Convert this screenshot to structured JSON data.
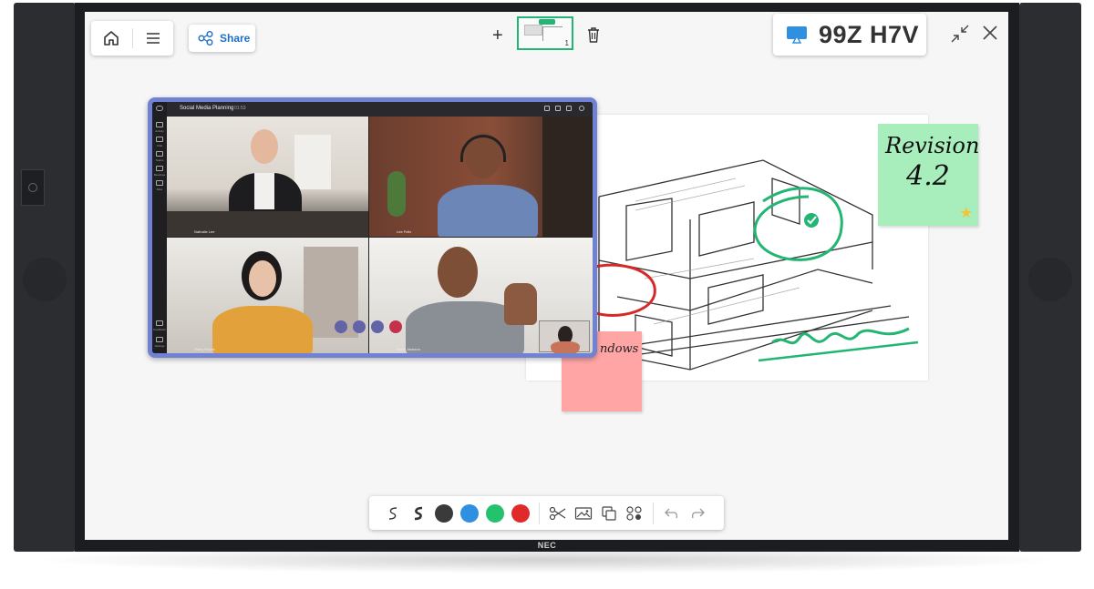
{
  "device": {
    "brand": "NEC"
  },
  "toolbar_top_left": {
    "home_icon": "home-icon",
    "menu_icon": "hamburger-menu-icon",
    "share_label": "Share",
    "share_icon": "share-icon"
  },
  "pages": {
    "add_icon": "plus-icon",
    "current_page_number": "1",
    "delete_icon": "trash-icon"
  },
  "session": {
    "cast_icon": "screen-cast-icon",
    "code": "99Z H7V"
  },
  "window_controls": {
    "collapse_icon": "collapse-icon",
    "close_icon": "close-icon"
  },
  "canvas": {
    "sticky_notes": [
      {
        "line1": "Revision",
        "line2": "4.2",
        "color": "#a8eebc"
      },
      {
        "text": "ndows",
        "color": "#ffa5a5"
      }
    ],
    "annotations": {
      "green": "#22b573",
      "red": "#d62a2a"
    }
  },
  "video_call": {
    "title": "Social Media Planning",
    "time": "01:53",
    "participants": [
      {
        "name": "Nathalie Lee"
      },
      {
        "name": "Lee Felix"
      },
      {
        "name": "Hilary Reyes"
      },
      {
        "name": "Kevin Jackson"
      }
    ],
    "rail_items": [
      "Activity",
      "Chat",
      "Teams",
      "Meetings",
      "Files",
      "Feedback",
      "Settings"
    ]
  },
  "pen_toolbar": {
    "pens": [
      "thin-pen-icon",
      "thick-pen-icon"
    ],
    "colors": [
      "#3a3a3a",
      "#2f8fe0",
      "#25c26e",
      "#e02a2a"
    ],
    "tools": [
      "scissors-icon",
      "image-icon",
      "duplicate-icon",
      "shapes-icon"
    ],
    "history": [
      "undo-icon",
      "redo-icon"
    ]
  }
}
